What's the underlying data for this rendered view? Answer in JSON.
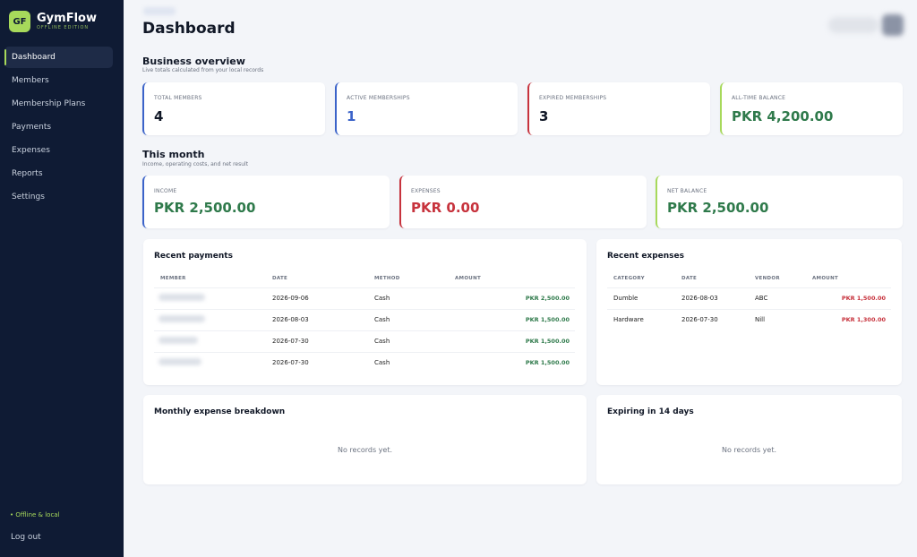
{
  "sidebar": {
    "logo_initials": "GF",
    "brand_name": "GymFlow",
    "brand_sub": "OFFLINE EDITION",
    "items": [
      {
        "label": "Dashboard",
        "active": true
      },
      {
        "label": "Members"
      },
      {
        "label": "Membership Plans"
      },
      {
        "label": "Payments"
      },
      {
        "label": "Expenses"
      },
      {
        "label": "Reports"
      },
      {
        "label": "Settings"
      }
    ],
    "status": "• Offline & local",
    "logout": "Log out"
  },
  "header": {
    "title": "Dashboard"
  },
  "overview": {
    "title": "Business overview",
    "subtitle": "Live totals calculated from your local records",
    "cards": [
      {
        "label": "TOTAL MEMBERS",
        "value": "4",
        "color": "#111827",
        "accent": "#3b63c9"
      },
      {
        "label": "ACTIVE MEMBERSHIPS",
        "value": "1",
        "color": "#3b63c9",
        "accent": "#3b63c9"
      },
      {
        "label": "EXPIRED MEMBERSHIPS",
        "value": "3",
        "color": "#111827",
        "accent": "#c7333d"
      },
      {
        "label": "ALL-TIME BALANCE",
        "value": "PKR 4,200.00",
        "color": "#2f7a4b",
        "accent": "#a7d95b"
      }
    ]
  },
  "month": {
    "title": "This month",
    "subtitle": "Income, operating costs, and net result",
    "cards": [
      {
        "label": "INCOME",
        "value": "PKR 2,500.00",
        "color": "#2f7a4b",
        "accent": "#3b63c9"
      },
      {
        "label": "EXPENSES",
        "value": "PKR 0.00",
        "color": "#c7333d",
        "accent": "#c7333d"
      },
      {
        "label": "NET BALANCE",
        "value": "PKR 2,500.00",
        "color": "#2f7a4b",
        "accent": "#a7d95b"
      }
    ]
  },
  "recent_payments": {
    "title": "Recent payments",
    "headers": [
      "MEMBER",
      "DATE",
      "METHOD",
      "AMOUNT"
    ],
    "rows": [
      {
        "date": "2026-09-06",
        "method": "Cash",
        "amount": "PKR 2,500.00"
      },
      {
        "date": "2026-08-03",
        "method": "Cash",
        "amount": "PKR 1,500.00"
      },
      {
        "date": "2026-07-30",
        "method": "Cash",
        "amount": "PKR 1,500.00"
      },
      {
        "date": "2026-07-30",
        "method": "Cash",
        "amount": "PKR 1,500.00"
      }
    ]
  },
  "recent_expenses": {
    "title": "Recent expenses",
    "headers": [
      "CATEGORY",
      "DATE",
      "VENDOR",
      "AMOUNT"
    ],
    "rows": [
      {
        "category": "Dumble",
        "date": "2026-08-03",
        "vendor": "ABC",
        "amount": "PKR 1,500.00"
      },
      {
        "category": "Hardware",
        "date": "2026-07-30",
        "vendor": "Nill",
        "amount": "PKR 1,300.00"
      }
    ]
  },
  "monthly_breakdown": {
    "title": "Monthly expense breakdown",
    "empty": "No records yet."
  },
  "expiring": {
    "title": "Expiring in 14 days",
    "empty": "No records yet."
  }
}
